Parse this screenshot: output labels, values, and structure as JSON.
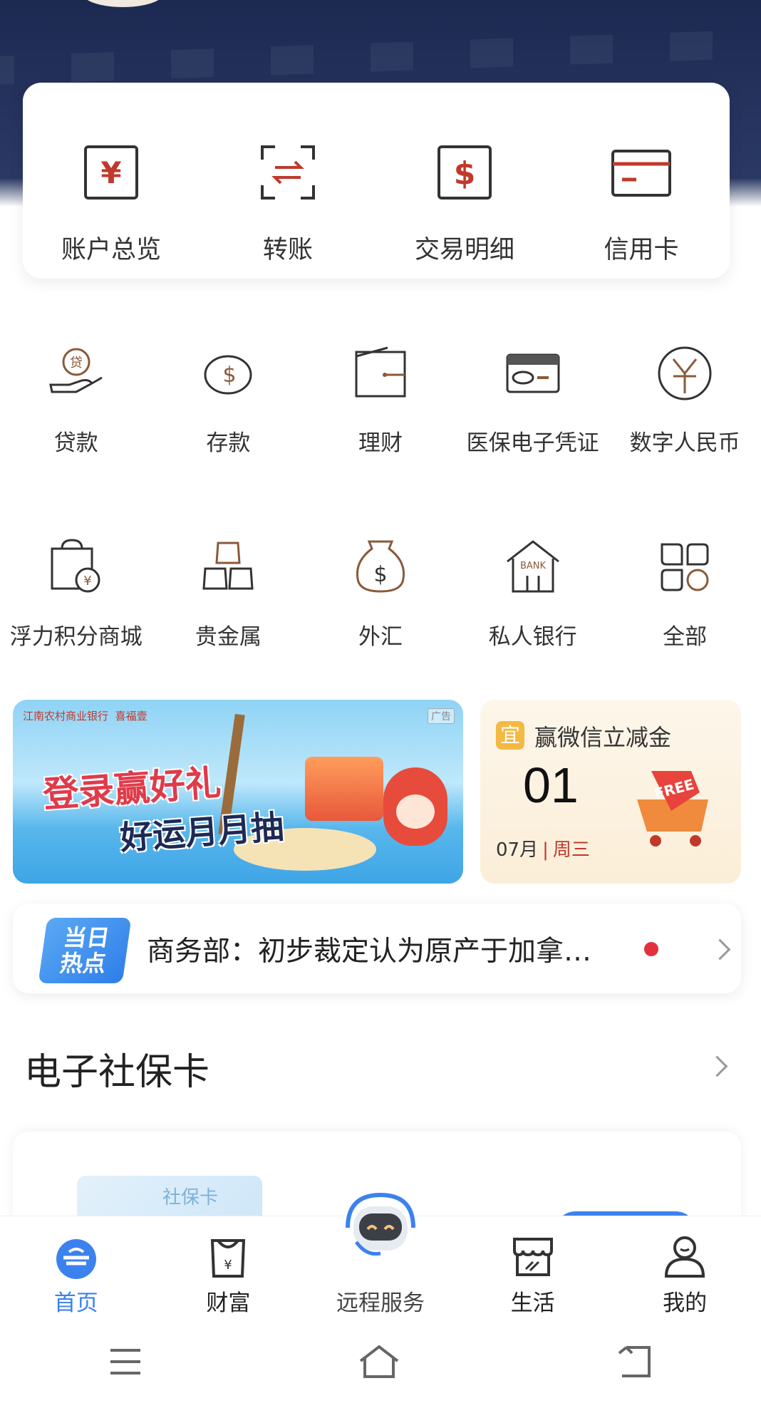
{
  "colors": {
    "header_bg": "#1c2a52",
    "accent_red": "#c0392b",
    "active_blue": "#3b82ef",
    "icon_brown": "#8a5a3a"
  },
  "quick_actions": [
    {
      "label": "账户总览",
      "icon": "yuan-box-icon"
    },
    {
      "label": "转账",
      "icon": "transfer-icon"
    },
    {
      "label": "交易明细",
      "icon": "dollar-box-icon"
    },
    {
      "label": "信用卡",
      "icon": "credit-card-icon"
    }
  ],
  "grid_row1": [
    {
      "label": "贷款",
      "icon": "loan-hand-icon"
    },
    {
      "label": "存款",
      "icon": "piggy-bank-icon"
    },
    {
      "label": "理财",
      "icon": "wallet-icon"
    },
    {
      "label": "医保电子凭证",
      "icon": "medical-card-icon"
    },
    {
      "label": "数字人民币",
      "icon": "digital-rmb-icon"
    }
  ],
  "grid_row2": [
    {
      "label": "浮力积分商城",
      "icon": "points-mall-icon"
    },
    {
      "label": "贵金属",
      "icon": "gold-bars-icon"
    },
    {
      "label": "外汇",
      "icon": "money-bag-icon"
    },
    {
      "label": "私人银行",
      "icon": "bank-building-icon"
    },
    {
      "label": "全部",
      "icon": "all-apps-icon"
    }
  ],
  "banner_left": {
    "bank_name": "江南农村商业银行",
    "partner": "喜福壹",
    "ad_tag": "广告",
    "line1": "登录赢好礼",
    "line2": "好运月月抽"
  },
  "banner_right": {
    "badge": "宜",
    "title": "赢微信立减金",
    "day": "01",
    "month": "07月",
    "weekday": "周三",
    "tag_text": "FREE"
  },
  "news": {
    "badge_line1": "当日",
    "badge_line2": "热点",
    "headline": "商务部：初步裁定认为原产于加拿…"
  },
  "section": {
    "title": "电子社保卡",
    "card_label": "社保卡"
  },
  "tabs": [
    {
      "label": "首页",
      "icon": "home-icon",
      "active": true
    },
    {
      "label": "财富",
      "icon": "wealth-bag-icon",
      "active": false
    },
    {
      "label": "远程服务",
      "icon": "robot-service-icon",
      "active": false
    },
    {
      "label": "生活",
      "icon": "store-icon",
      "active": false
    },
    {
      "label": "我的",
      "icon": "user-icon",
      "active": false
    }
  ]
}
